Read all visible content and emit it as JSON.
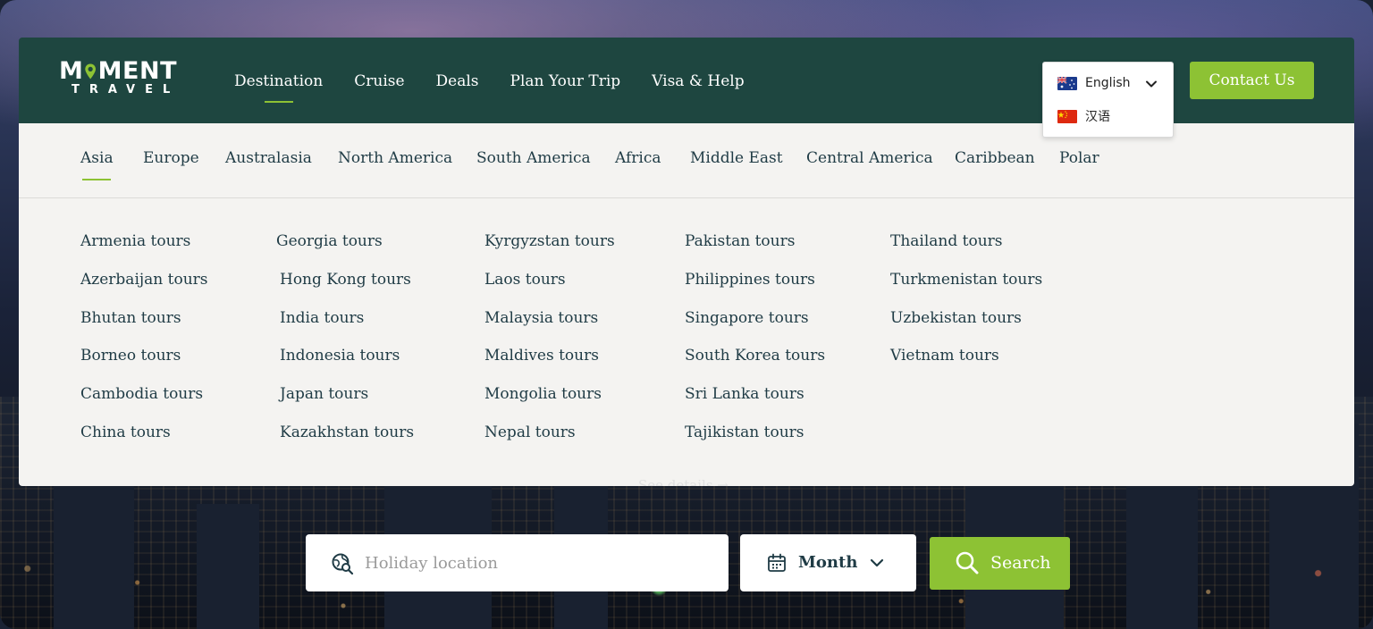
{
  "header": {
    "logo_top_left": "M",
    "logo_top_right": "MENT",
    "logo_bottom": "TRAVEL",
    "nav": [
      "Destination",
      "Cruise",
      "Deals",
      "Plan Your Trip",
      "Visa & Help"
    ],
    "active_nav": "Destination",
    "contact_label": "Contact Us"
  },
  "language": {
    "selected": "English",
    "options": [
      "English",
      "汉语"
    ]
  },
  "regions": [
    "Asia",
    "Europe",
    "Australasia",
    "North America",
    "South America",
    "Africa",
    "Middle East",
    "Central America",
    "Caribbean",
    "Polar"
  ],
  "active_region": "Asia",
  "tours": [
    [
      "Armenia tours",
      "Azerbaijan tours",
      "Bhutan tours",
      "Borneo tours",
      "Cambodia tours",
      "China tours"
    ],
    [
      "Georgia tours",
      "Hong Kong tours",
      "India tours",
      "Indonesia tours",
      "Japan tours",
      "Kazakhstan tours"
    ],
    [
      "Kyrgyzstan tours",
      "Laos tours",
      "Malaysia tours",
      "Maldives tours",
      "Mongolia tours",
      "Nepal tours"
    ],
    [
      "Pakistan tours",
      "Philippines tours",
      "Singapore tours",
      "South Korea tours",
      "Sri Lanka tours",
      "Tajikistan tours"
    ],
    [
      "Thailand tours",
      "Turkmenistan tours",
      "Uzbekistan tours",
      "Vietnam tours"
    ]
  ],
  "see_details": "See details →",
  "search": {
    "placeholder": "Holiday location",
    "month_label": "Month",
    "button_label": "Search"
  },
  "colors": {
    "header_bg": "#1e4640",
    "accent_green": "#8dc234",
    "panel_bg": "#f4f3f1",
    "text_dark": "#1f3b45"
  }
}
